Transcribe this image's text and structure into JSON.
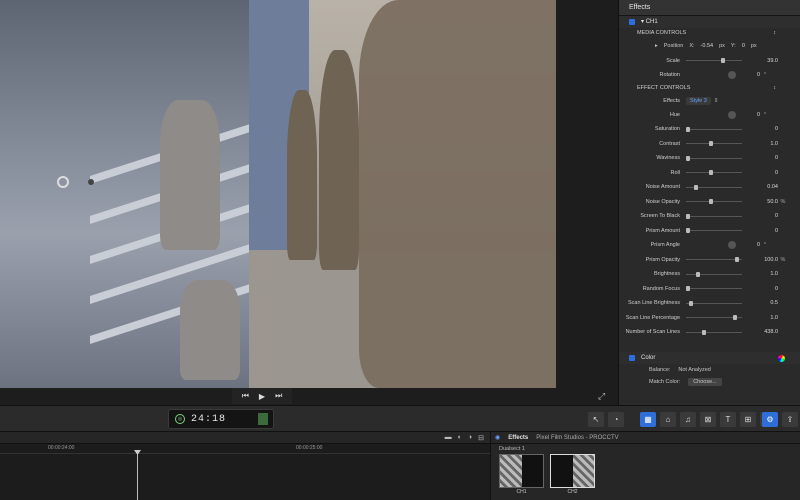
{
  "inspector": {
    "title": "Effects",
    "effect_name": "CH1",
    "media_controls": "MEDIA CONTROLS",
    "position": {
      "label": "Position",
      "x_label": "X:",
      "x_val": "-0.54",
      "x_unit": "px",
      "y_label": "Y:",
      "y_val": "0",
      "y_unit": "px"
    },
    "scale": {
      "label": "Scale",
      "value": "39.0"
    },
    "rotation": {
      "label": "Rotation",
      "value": "0",
      "unit": "°"
    },
    "effect_controls": "EFFECT CONTROLS",
    "effects_label": "Effects",
    "effects_value": "Style 3",
    "params": [
      {
        "label": "Hue",
        "value": "0",
        "unit": "°",
        "dial": true
      },
      {
        "label": "Saturation",
        "value": "0",
        "knob": 0.0
      },
      {
        "label": "Contrast",
        "value": "1.0",
        "knob": 0.45
      },
      {
        "label": "Waviness",
        "value": "0",
        "knob": 0.0
      },
      {
        "label": "Roll",
        "value": "0",
        "knob": 0.45
      },
      {
        "label": "Noise Amount",
        "value": "0.04",
        "knob": 0.15
      },
      {
        "label": "Noise Opacity",
        "value": "50.0",
        "unit": "%",
        "knob": 0.45
      },
      {
        "label": "Screen To Black",
        "value": "0",
        "knob": 0.0
      },
      {
        "label": "Prism Amount",
        "value": "0",
        "knob": 0.0
      },
      {
        "label": "Prism Angle",
        "value": "0",
        "unit": "°",
        "dial": true
      },
      {
        "label": "Prism Opacity",
        "value": "100.0",
        "unit": "%",
        "knob": 0.95
      },
      {
        "label": "Brightness",
        "value": "1.0",
        "knob": 0.2
      },
      {
        "label": "Random Focus",
        "value": "0",
        "knob": 0.0
      },
      {
        "label": "Scan Line Brightness",
        "value": "0.5",
        "knob": 0.05
      },
      {
        "label": "Scan Line Percentage",
        "value": "1.0",
        "knob": 0.9
      },
      {
        "label": "Number of Scan Lines",
        "value": "438.0",
        "knob": 0.3
      }
    ],
    "color": {
      "title": "Color",
      "balance_label": "Balance:",
      "balance_value": "Not Analyzed",
      "match_label": "Match Color:",
      "match_value": "Choose..."
    }
  },
  "toolbar": {
    "timecode": "24:18"
  },
  "timeline": {
    "ruler": [
      "00:00:24:00",
      "00:00:25:00"
    ]
  },
  "effects_browser": {
    "title": "Effects",
    "path": "Pixel Film Studios - PROCCTV",
    "group": "Dualsect 1",
    "thumbs": [
      {
        "label": "CH1"
      },
      {
        "label": "CH2"
      }
    ]
  }
}
